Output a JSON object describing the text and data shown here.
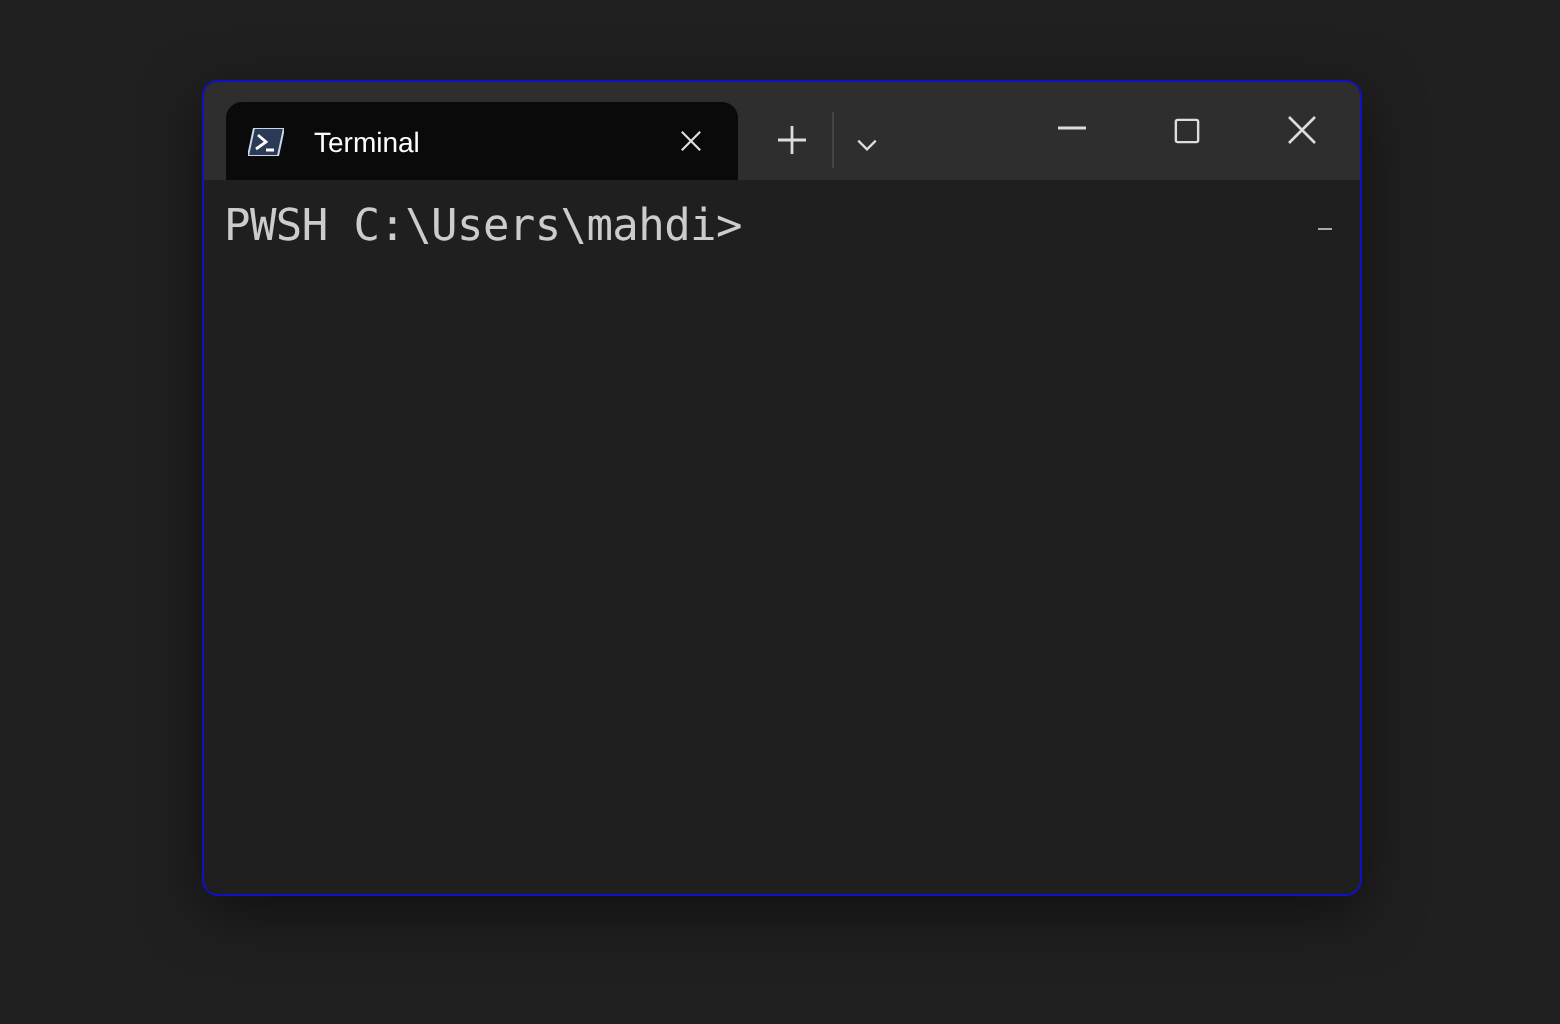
{
  "tabs": [
    {
      "label": "Terminal",
      "selected": true
    }
  ],
  "terminal": {
    "lines": [
      "PWSH C:\\Users\\mahdi>"
    ]
  }
}
